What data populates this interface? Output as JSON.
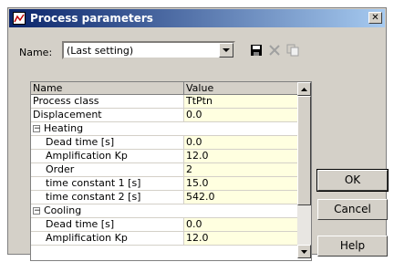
{
  "dialog": {
    "title": "Process parameters",
    "close_glyph": "✕"
  },
  "name_row": {
    "label": "Name:",
    "value": "(Last setting)"
  },
  "grid": {
    "columns": [
      "Name",
      "Value"
    ],
    "rows": [
      {
        "name": "Process class",
        "value": "TtPtn",
        "group": false
      },
      {
        "name": "Displacement",
        "value": "0.0",
        "group": false
      },
      {
        "name": "Heating",
        "value": "",
        "group": true,
        "expander": "−"
      },
      {
        "name": "Dead time [s]",
        "value": "0.0",
        "group": false
      },
      {
        "name": "Amplification Kp",
        "value": "12.0",
        "group": false
      },
      {
        "name": "Order",
        "value": "2",
        "group": false
      },
      {
        "name": "time constant 1 [s]",
        "value": "15.0",
        "group": false
      },
      {
        "name": "time constant 2 [s]",
        "value": "542.0",
        "group": false
      },
      {
        "name": "Cooling",
        "value": "",
        "group": true,
        "expander": "−"
      },
      {
        "name": "Dead time [s]",
        "value": "0.0",
        "group": false
      },
      {
        "name": "Amplification Kp",
        "value": "12.0",
        "group": false
      }
    ]
  },
  "buttons": {
    "ok": "OK",
    "cancel": "Cancel",
    "help": "Help"
  },
  "icons": {
    "save": "save-icon",
    "delete": "delete-icon",
    "copy": "copy-icon"
  }
}
